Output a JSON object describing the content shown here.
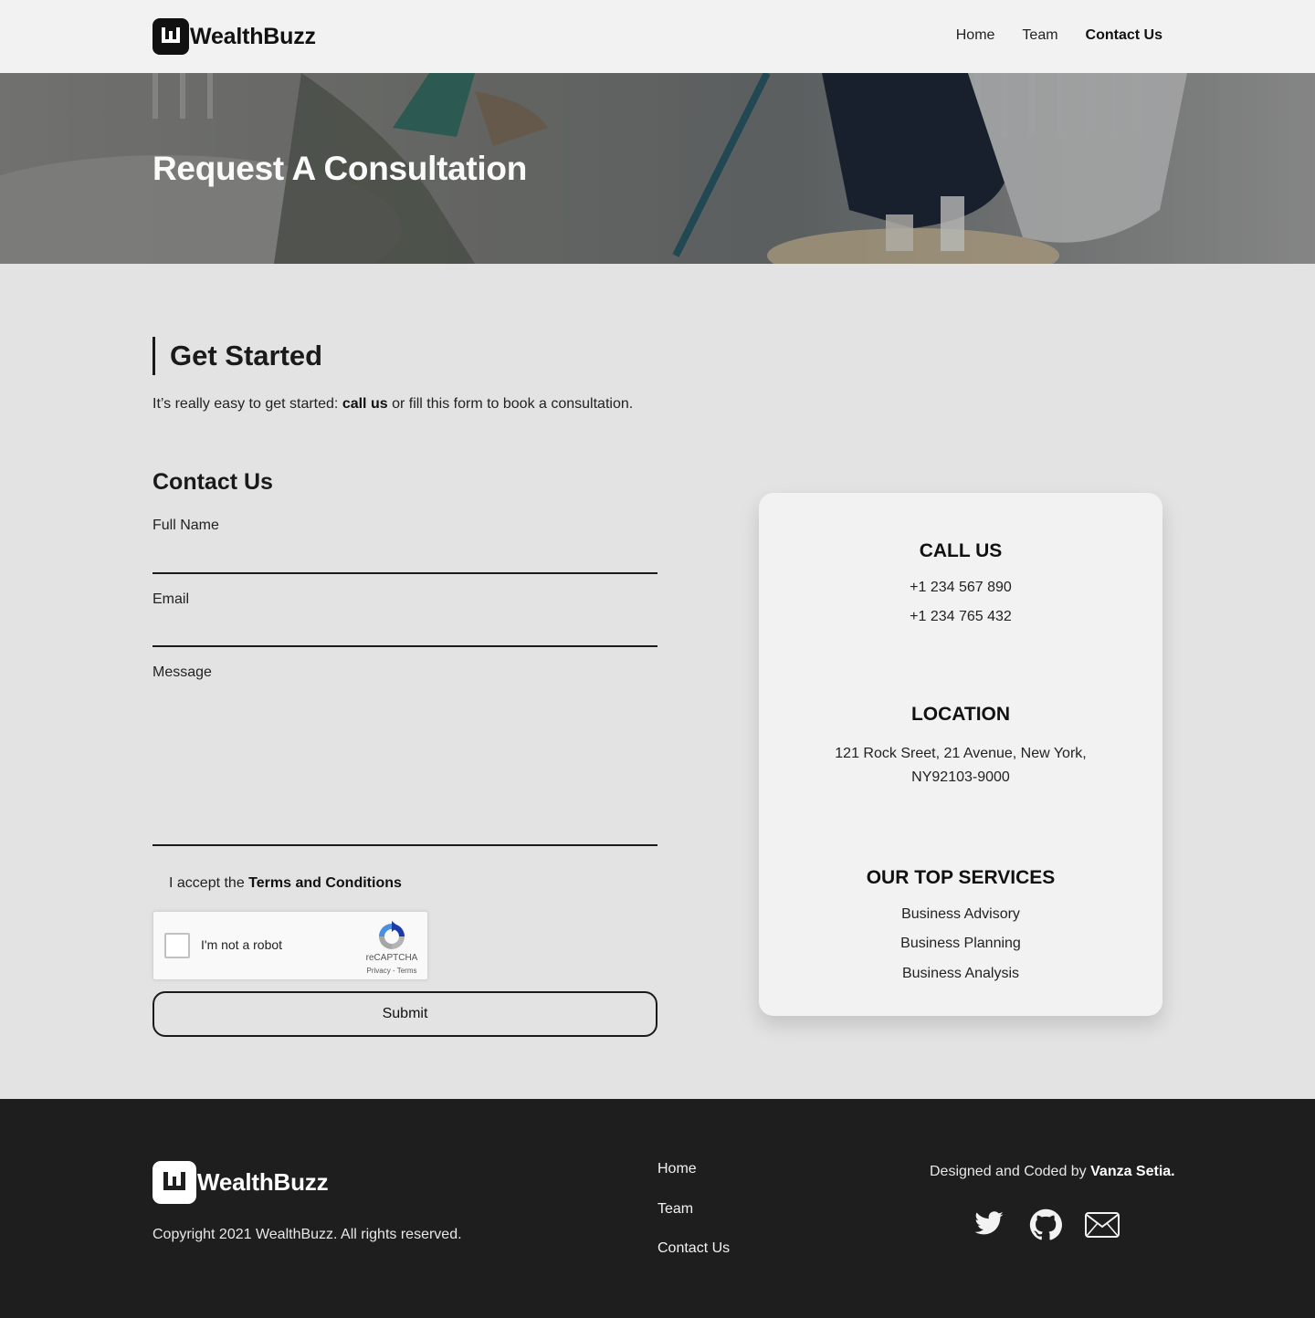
{
  "brand": {
    "name": "WealthBuzz"
  },
  "nav": {
    "items": [
      {
        "label": "Home",
        "active": false
      },
      {
        "label": "Team",
        "active": false
      },
      {
        "label": "Contact Us",
        "active": true
      }
    ]
  },
  "hero": {
    "title": "Request A Consultation"
  },
  "get_started": {
    "title": "Get Started",
    "intro_prefix": "It’s really easy to get started: ",
    "intro_bold": "call us",
    "intro_suffix": " or fill this form to book a consultation."
  },
  "form": {
    "title": "Contact Us",
    "full_name_label": "Full Name",
    "full_name_value": "",
    "email_label": "Email",
    "email_value": "",
    "message_label": "Message",
    "message_value": "",
    "terms_prefix": "I accept the ",
    "terms_link": "Terms and Conditions",
    "captcha_text": "I'm not a robot",
    "captcha_brand": "reCAPTCHA",
    "captcha_links": "Privacy - Terms",
    "submit_label": "Submit"
  },
  "info_card": {
    "call_title": "CALL US",
    "phones": [
      "+1 234 567 890",
      "+1 234 765 432"
    ],
    "location_title": "LOCATION",
    "address_line1": "121 Rock Sreet, 21 Avenue, New York,",
    "address_line2": "NY92103-9000",
    "services_title": "OUR TOP SERVICES",
    "services": [
      "Business Advisory",
      "Business Planning",
      "Business Analysis"
    ]
  },
  "footer": {
    "brand": "WealthBuzz",
    "copyright": "Copyright 2021 WealthBuzz. All rights reserved.",
    "nav": [
      "Home",
      "Team",
      "Contact Us"
    ],
    "credit_prefix": "Designed and Coded by ",
    "credit_name": "Vanza Setia.",
    "social_icons": [
      "twitter-icon",
      "github-icon",
      "mail-icon"
    ]
  },
  "colors": {
    "header_bg": "#f2f2f2",
    "page_bg": "#e3e3e3",
    "card_bg": "#f2f2f2",
    "footer_bg": "#1e1e1e",
    "text": "#1a1a1a"
  }
}
